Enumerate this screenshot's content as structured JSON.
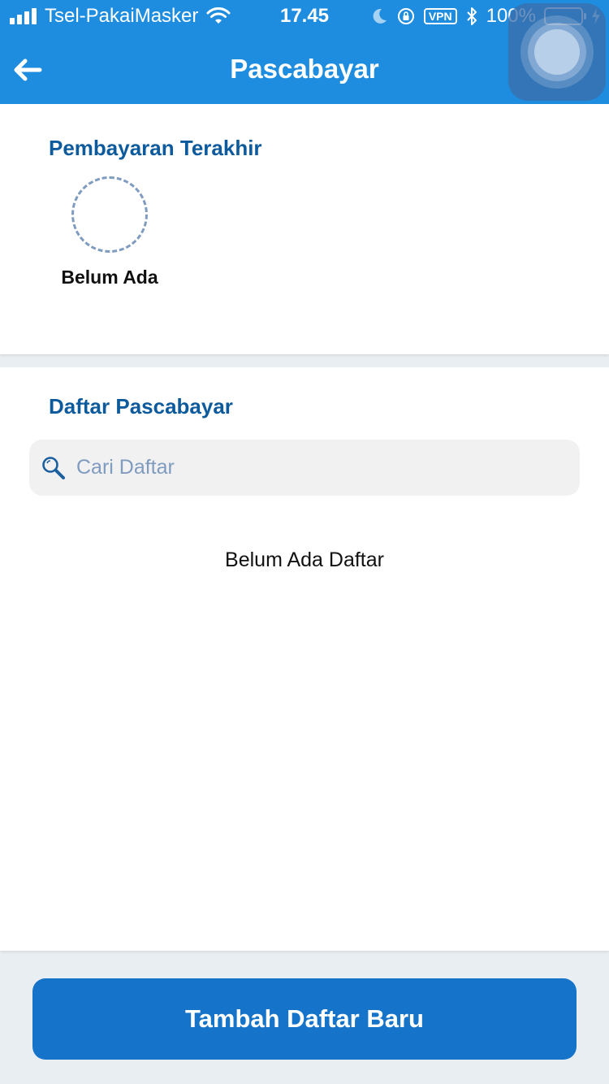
{
  "status_bar": {
    "carrier": "Tsel-PakaiMasker",
    "time": "17.45",
    "vpn_label": "VPN",
    "battery_percent": "100%",
    "battery_level": 1.0,
    "icons": [
      "signal-icon",
      "wifi-icon",
      "moon-icon",
      "rotation-lock-icon",
      "vpn-icon",
      "bluetooth-icon",
      "battery-icon",
      "charging-icon"
    ]
  },
  "header": {
    "title": "Pascabayar",
    "back_icon": "arrow-left-icon",
    "background_color": "#1e8ddf"
  },
  "recent_payments": {
    "title": "Pembayaran Terakhir",
    "empty_label": "Belum Ada"
  },
  "postpaid_list": {
    "title": "Daftar Pascabayar",
    "search": {
      "placeholder": "Cari Daftar",
      "value": "",
      "icon": "search-icon"
    },
    "empty_message": "Belum Ada Daftar"
  },
  "footer": {
    "add_button_label": "Tambah Daftar Baru",
    "button_color": "#1574c9"
  },
  "colors": {
    "title_blue": "#0d5a9c",
    "placeholder": "#7f9bbf",
    "page_background": "#e9eef2"
  }
}
